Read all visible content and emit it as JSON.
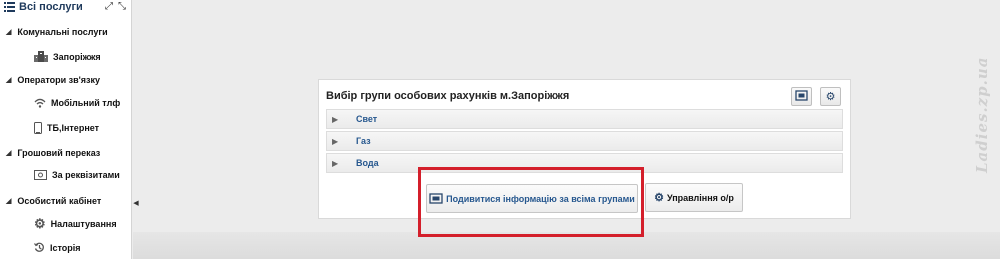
{
  "sidebar": {
    "title": "Всі послуги",
    "groups": [
      {
        "label": "Комунальні послуги",
        "items": [
          {
            "label": "Запоріжжя",
            "icon": "building-icon"
          }
        ]
      },
      {
        "label": "Оператори зв'язку",
        "items": [
          {
            "label": "Мобільний тлф",
            "icon": "wifi-icon"
          },
          {
            "label": "ТБ,Інтернет",
            "icon": "phone-icon"
          }
        ]
      },
      {
        "label": "Грошовий переказ",
        "items": [
          {
            "label": "За реквізитами",
            "icon": "banknote-icon"
          }
        ]
      },
      {
        "label": "Особистий кабінет",
        "items": [
          {
            "label": "Налаштування",
            "icon": "gear-icon"
          },
          {
            "label": "Історія",
            "icon": "history-icon"
          }
        ]
      }
    ]
  },
  "panel": {
    "title": "Вибір групи особових рахунків м.Запоріжжя",
    "rows": [
      "Свет",
      "Газ",
      "Вода"
    ],
    "buttons": {
      "view_all": "Подивитися інформацію за всіма групами",
      "manage": "Управління о/р"
    }
  },
  "watermark": "Ladies.zp.ua",
  "colors": {
    "highlight": "#d41f2b",
    "link": "#27588f",
    "title": "#1f3a5c"
  }
}
